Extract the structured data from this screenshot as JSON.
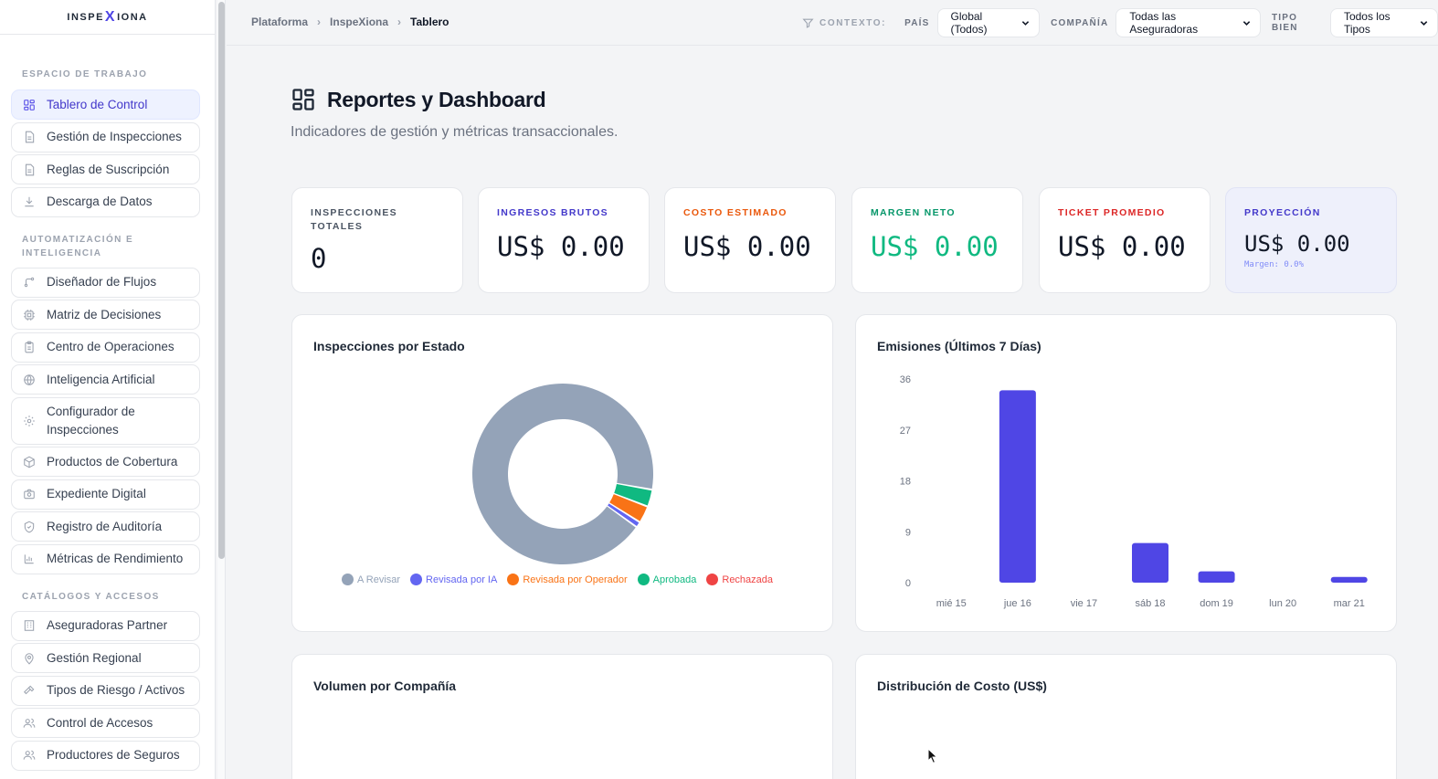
{
  "app": {
    "logo_left": "INSPE",
    "logo_x": "X",
    "logo_right": "IONA"
  },
  "sidebar": {
    "sections": [
      {
        "title": "ESPACIO DE TRABAJO",
        "items": [
          {
            "label": "Tablero de Control",
            "icon": "dashboard-icon",
            "active": true
          },
          {
            "label": "Gestión de Inspecciones",
            "icon": "document-icon"
          },
          {
            "label": "Reglas de Suscripción",
            "icon": "document-icon"
          },
          {
            "label": "Descarga de Datos",
            "icon": "download-icon"
          }
        ]
      },
      {
        "title": "AUTOMATIZACIÓN E INTELIGENCIA",
        "items": [
          {
            "label": "Diseñador de Flujos",
            "icon": "flow-icon"
          },
          {
            "label": "Matriz de Decisiones",
            "icon": "chip-icon"
          },
          {
            "label": "Centro de Operaciones",
            "icon": "clipboard-icon"
          },
          {
            "label": "Inteligencia Artificial",
            "icon": "globe-icon"
          },
          {
            "label": "Configurador de Inspecciones",
            "icon": "gear-icon"
          },
          {
            "label": "Productos de Cobertura",
            "icon": "box-icon"
          },
          {
            "label": "Expediente Digital",
            "icon": "camera-icon"
          },
          {
            "label": "Registro de Auditoría",
            "icon": "shield-icon"
          },
          {
            "label": "Métricas de Rendimiento",
            "icon": "bar-chart-icon"
          }
        ]
      },
      {
        "title": "CATÁLOGOS Y ACCESOS",
        "items": [
          {
            "label": "Aseguradoras Partner",
            "icon": "building-icon"
          },
          {
            "label": "Gestión Regional",
            "icon": "map-pin-icon"
          },
          {
            "label": "Tipos de Riesgo / Activos",
            "icon": "hammer-icon"
          },
          {
            "label": "Control de Accesos",
            "icon": "users-icon"
          },
          {
            "label": "Productores de Seguros",
            "icon": "users-icon"
          }
        ]
      }
    ]
  },
  "breadcrumb": [
    "Plataforma",
    "InspeXiona",
    "Tablero"
  ],
  "context": {
    "label": "CONTEXTO:",
    "pais_label": "PAÍS",
    "pais_value": "Global (Todos)",
    "compania_label": "COMPAÑÍA",
    "compania_value": "Todas las Aseguradoras",
    "tipo_label": "TIPO BIEN",
    "tipo_value": "Todos los Tipos"
  },
  "page": {
    "title": "Reportes y Dashboard",
    "subtitle": "Indicadores de gestión y métricas transaccionales."
  },
  "kpis": [
    {
      "label": "INSPECCIONES TOTALES",
      "value": "0",
      "color": "#4b5563",
      "value_color": "#111827"
    },
    {
      "label": "INGRESOS BRUTOS",
      "value": "US$ 0.00",
      "color": "#4338ca",
      "value_color": "#111827"
    },
    {
      "label": "COSTO ESTIMADO",
      "value": "US$ 0.00",
      "color": "#ea580c",
      "value_color": "#111827"
    },
    {
      "label": "MARGEN NETO",
      "value": "US$ 0.00",
      "color": "#059669",
      "value_color": "#10b981"
    },
    {
      "label": "TICKET PROMEDIO",
      "value": "US$ 0.00",
      "color": "#dc2626",
      "value_color": "#111827"
    },
    {
      "label": "PROYECCIÓN",
      "value": "US$ 0.00",
      "sub": "Margen: 0.0%",
      "color": "#4338ca",
      "value_color": "#111827"
    }
  ],
  "cards": {
    "estado_title": "Inspecciones por Estado",
    "emisiones_title": "Emisiones (Últimos 7 Días)",
    "volumen_title": "Volumen por Compañía",
    "costo_title": "Distribución de Costo (US$)"
  },
  "chart_data": [
    {
      "type": "pie",
      "title": "Inspecciones por Estado",
      "categories": [
        "A Revisar",
        "Revisada por IA",
        "Revisada por Operador",
        "Aprobada",
        "Rechazada"
      ],
      "values": [
        91,
        1,
        3,
        3,
        0
      ],
      "colors": [
        "#94a3b8",
        "#6366f1",
        "#f97316",
        "#10b981",
        "#ef4444"
      ],
      "legend": "bottom"
    },
    {
      "type": "bar",
      "title": "Emisiones (Últimos 7 Días)",
      "categories": [
        "mié 15",
        "jue 16",
        "vie 17",
        "sáb 18",
        "dom 19",
        "lun 20",
        "mar 21"
      ],
      "values": [
        0,
        34,
        0,
        7,
        2,
        0,
        1
      ],
      "yticks": [
        "0",
        "9",
        "18",
        "27",
        "36"
      ],
      "ylim": [
        0,
        36
      ],
      "color": "#4f46e5"
    }
  ]
}
